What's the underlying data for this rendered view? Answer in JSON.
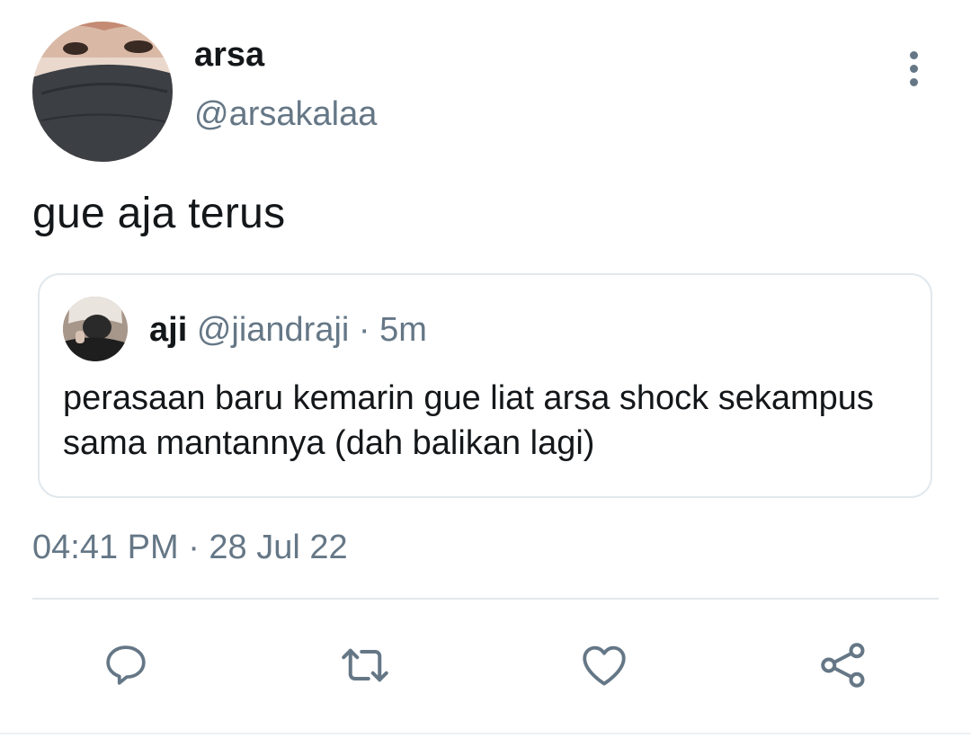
{
  "tweet": {
    "author_name": "arsa",
    "author_handle": "@arsakalaa",
    "text": "gue aja terus",
    "timestamp": "04:41 PM · 28 Jul 22"
  },
  "quoted": {
    "name": "aji",
    "handle": "@jiandraji",
    "separator": "·",
    "time": "5m",
    "text": "perasaan baru kemarin gue liat arsa shock sekampus sama mantannya (dah balikan lagi)"
  },
  "icons": {
    "more": "more-vertical-icon",
    "reply": "reply-icon",
    "retweet": "retweet-icon",
    "like": "heart-icon",
    "share": "share-icon"
  },
  "colors": {
    "text": "#14171a",
    "secondary": "#657786",
    "border": "#e1e8ed"
  }
}
